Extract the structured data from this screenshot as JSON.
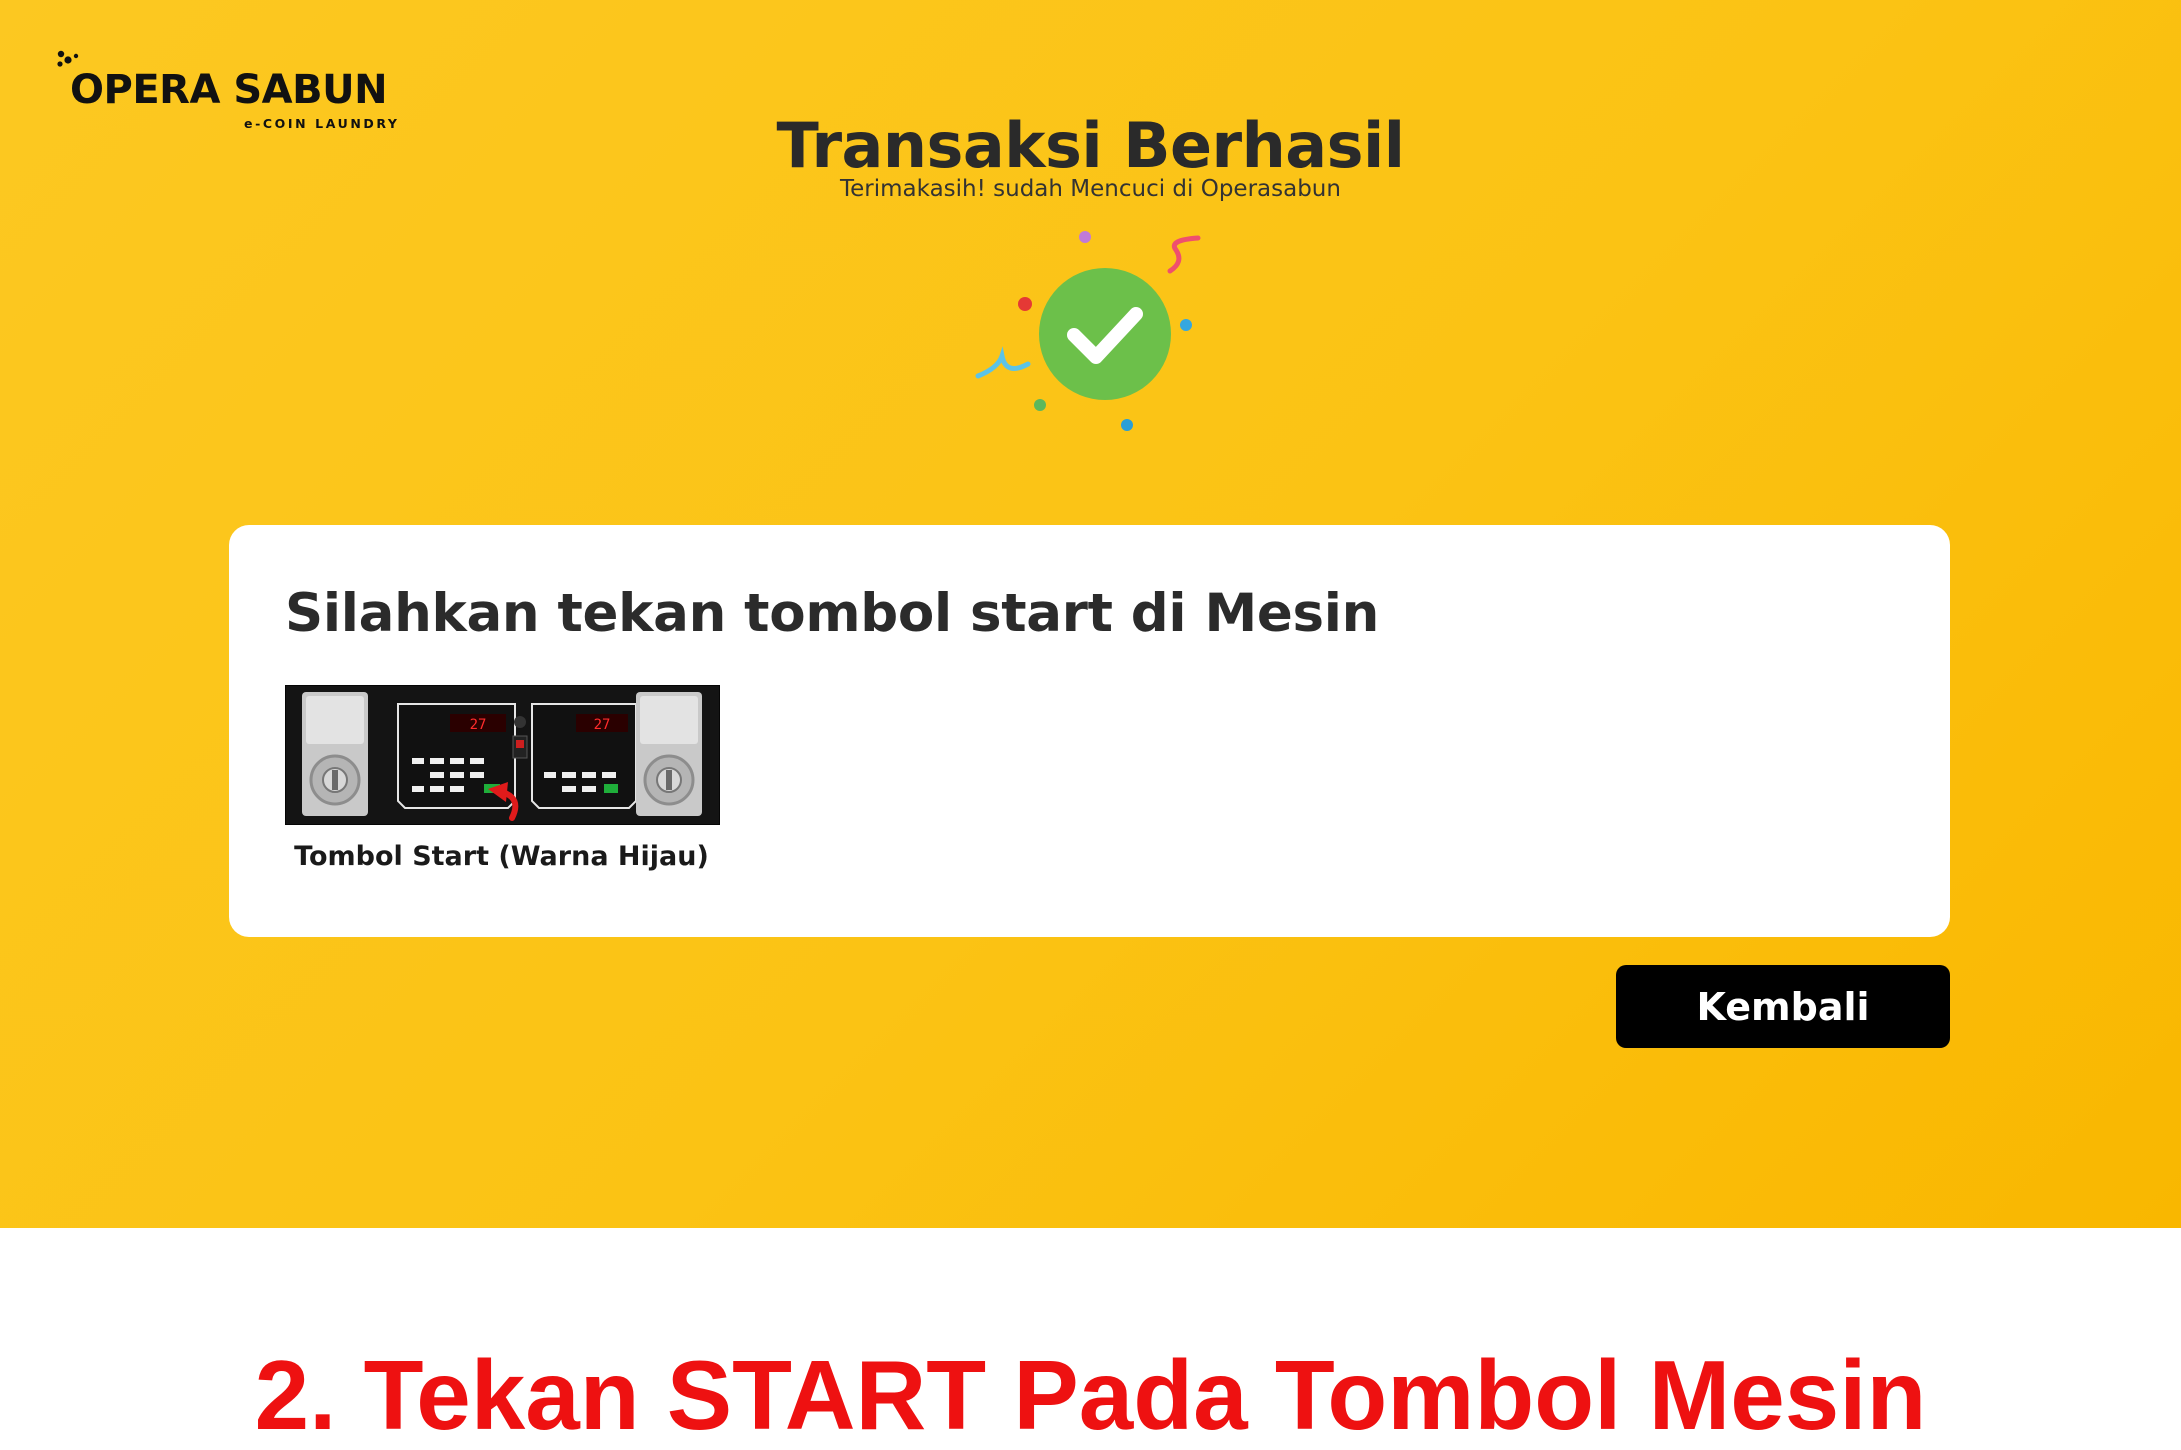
{
  "brand": {
    "name": "OPERA SABUN",
    "tagline": "e-COIN LAUNDRY"
  },
  "header": {
    "title": "Transaksi Berhasil",
    "subtitle": "Terimakasih! sudah Mencuci di Operasabun"
  },
  "card": {
    "title": "Silahkan tekan tombol start di Mesin",
    "image_caption": "Tombol Start (Warna Hijau)"
  },
  "actions": {
    "back_label": "Kembali"
  },
  "instruction": {
    "text": "2.  Tekan START Pada Tombol Mesin"
  },
  "icons": {
    "success": "check-circle-icon",
    "logo": "bubbles-icon"
  },
  "colors": {
    "background": "#fbc314",
    "success_green": "#6cc04a",
    "button": "#000000",
    "instruction_red": "#ee1111"
  }
}
